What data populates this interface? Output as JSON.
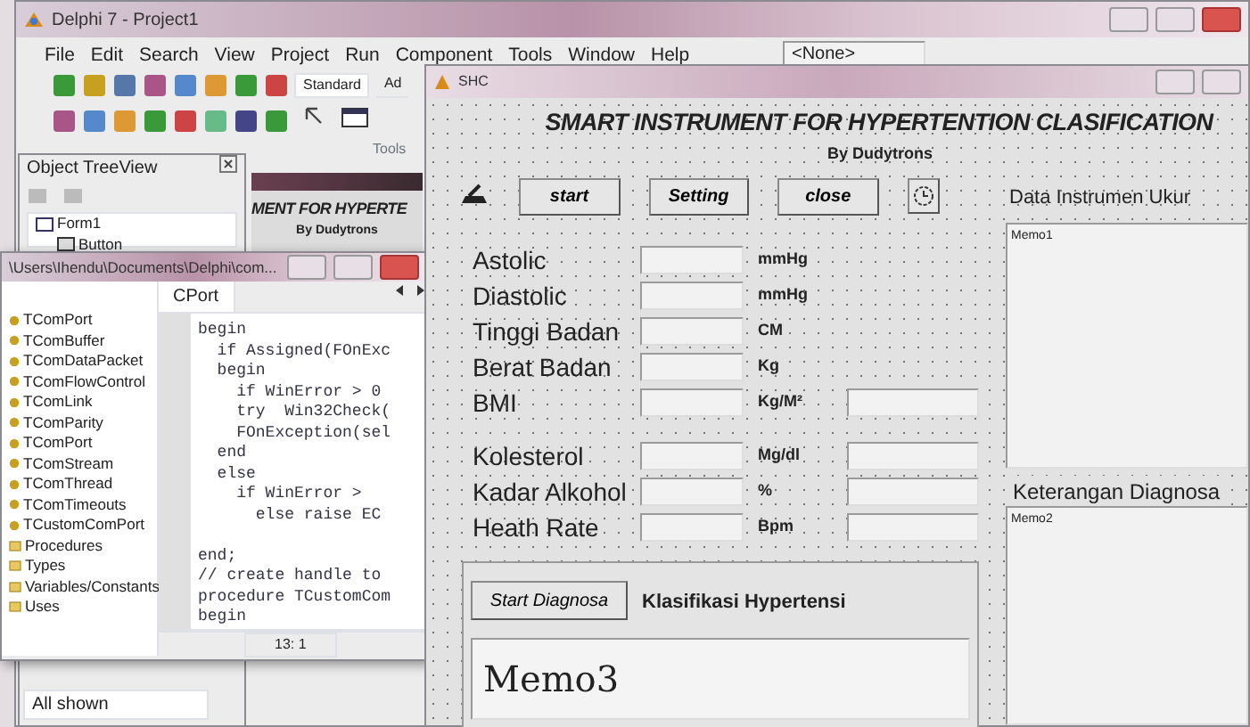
{
  "ide": {
    "title": "Delphi 7 - Project1",
    "menu": [
      "File",
      "Edit",
      "Search",
      "View",
      "Project",
      "Run",
      "Component",
      "Tools",
      "Window",
      "Help"
    ],
    "component_combo": "<None>",
    "palette_tabs": [
      {
        "label": "Standard",
        "selected": true
      },
      {
        "label": "Ad",
        "selected": false
      }
    ],
    "palette_caption": "Tools"
  },
  "object_treeview": {
    "title": "Object TreeView",
    "items": [
      {
        "label": "Form1",
        "children": [
          {
            "label": "Button"
          }
        ]
      }
    ],
    "status": "All shown"
  },
  "background_form_preview": {
    "heading": "MENT FOR HYPERTE",
    "byline": "By Dudytrons"
  },
  "code_editor": {
    "title": "\\Users\\Ihendu\\Documents\\Delphi\\com...",
    "explorer": [
      {
        "label": "TComPort",
        "kind": "class"
      },
      {
        "label": "TComBuffer",
        "kind": "class"
      },
      {
        "label": "TComDataPacket",
        "kind": "class"
      },
      {
        "label": "TComFlowControl",
        "kind": "class"
      },
      {
        "label": "TComLink",
        "kind": "class"
      },
      {
        "label": "TComParity",
        "kind": "class"
      },
      {
        "label": "TComPort",
        "kind": "class"
      },
      {
        "label": "TComStream",
        "kind": "class"
      },
      {
        "label": "TComThread",
        "kind": "class"
      },
      {
        "label": "TComTimeouts",
        "kind": "class"
      },
      {
        "label": "TCustomComPort",
        "kind": "class"
      },
      {
        "label": "Procedures",
        "kind": "folder"
      },
      {
        "label": "Types",
        "kind": "folder"
      },
      {
        "label": "Variables/Constants",
        "kind": "folder"
      },
      {
        "label": "Uses",
        "kind": "folder"
      }
    ],
    "tabs": [
      {
        "label": "CPort",
        "selected": true
      }
    ],
    "code_blocks": [
      [
        "begin",
        "  if Assigned(FOnExc",
        "  begin",
        "    if WinError > 0",
        "    try  Win32Check(",
        "    FOnException(sel",
        "  end",
        "  else",
        "    if WinError >",
        "      else raise EC"
      ],
      [
        "end;",
        "// create handle to",
        "procedure TCustomCom",
        "begin"
      ]
    ],
    "status": "13: 1"
  },
  "form": {
    "title": "SHC",
    "heading": "SMART INSTRUMENT FOR HYPERTENTION CLASIFICATION",
    "byline": "By Dudytrons",
    "buttons": [
      "start",
      "Setting",
      "close"
    ],
    "body_fields": [
      {
        "label": "Astolic",
        "unit": "mmHg",
        "result_field": false
      },
      {
        "label": "Diastolic",
        "unit": "mmHg",
        "result_field": false
      },
      {
        "label": "Tinggi Badan",
        "unit": "CM",
        "result_field": false
      },
      {
        "label": "Berat Badan",
        "unit": "Kg",
        "result_field": false
      },
      {
        "label": "BMI",
        "unit": "Kg/M²",
        "result_field": true
      }
    ],
    "lab_fields": [
      {
        "label": "Kolesterol",
        "unit": "Mg/dl",
        "result_field": true
      },
      {
        "label": "Kadar Alkohol",
        "unit": "%",
        "result_field": true
      },
      {
        "label": "Heath Rate",
        "unit": "Bpm",
        "result_field": true
      }
    ],
    "data_panel_title": "Data Instrumen Ukur",
    "memo1": "Memo1",
    "diagnosis_title": "Keterangan Diagnosa",
    "memo2": "Memo2",
    "diagnose_button": "Start Diagnosa",
    "classification_title": "Klasifikasi Hypertensi",
    "memo3": "Memo3"
  }
}
